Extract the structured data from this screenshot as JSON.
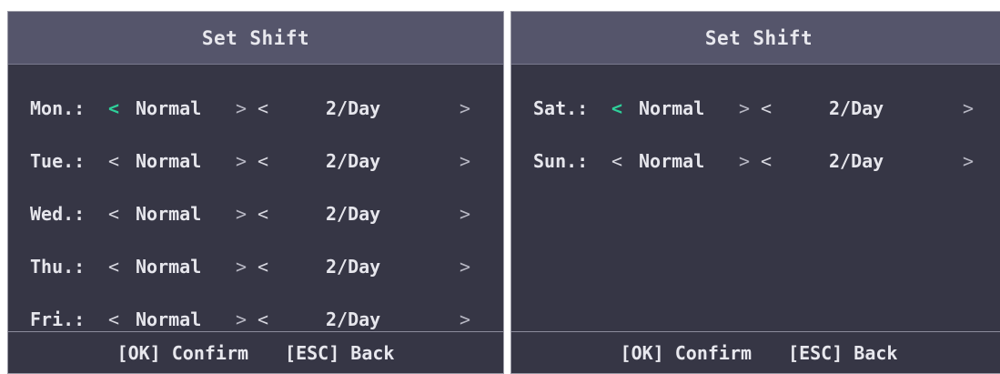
{
  "panels": [
    {
      "title": "Set Shift",
      "rows": [
        {
          "day": "Mon.:",
          "prev_arrow": "<",
          "type": "Normal",
          "next_arrow": ">",
          "freq_prev_arrow": "<",
          "frequency": "2/Day",
          "freq_next_arrow": ">"
        },
        {
          "day": "Tue.:",
          "prev_arrow": "<",
          "type": "Normal",
          "next_arrow": ">",
          "freq_prev_arrow": "<",
          "frequency": "2/Day",
          "freq_next_arrow": ">"
        },
        {
          "day": "Wed.:",
          "prev_arrow": "<",
          "type": "Normal",
          "next_arrow": ">",
          "freq_prev_arrow": "<",
          "frequency": "2/Day",
          "freq_next_arrow": ">"
        },
        {
          "day": "Thu.:",
          "prev_arrow": "<",
          "type": "Normal",
          "next_arrow": ">",
          "freq_prev_arrow": "<",
          "frequency": "2/Day",
          "freq_next_arrow": ">"
        },
        {
          "day": "Fri.:",
          "prev_arrow": "<",
          "type": "Normal",
          "next_arrow": ">",
          "freq_prev_arrow": "<",
          "frequency": "2/Day",
          "freq_next_arrow": ">"
        }
      ],
      "footer": {
        "confirm": "[OK] Confirm",
        "back": "[ESC] Back"
      }
    },
    {
      "title": "Set Shift",
      "rows": [
        {
          "day": "Sat.:",
          "prev_arrow": "<",
          "type": "Normal",
          "next_arrow": ">",
          "freq_prev_arrow": "<",
          "frequency": "2/Day",
          "freq_next_arrow": ">"
        },
        {
          "day": "Sun.:",
          "prev_arrow": "<",
          "type": "Normal",
          "next_arrow": ">",
          "freq_prev_arrow": "<",
          "frequency": "2/Day",
          "freq_next_arrow": ">"
        }
      ],
      "footer": {
        "confirm": "[OK] Confirm",
        "back": "[ESC] Back"
      }
    }
  ],
  "colors": {
    "panel_bg": "#363645",
    "title_bg": "#55556b",
    "text": "#e6e6ec",
    "active_arrow": "#2ed19a"
  },
  "icons": {
    "prev": "chevron-left-icon",
    "next": "chevron-right-icon"
  }
}
